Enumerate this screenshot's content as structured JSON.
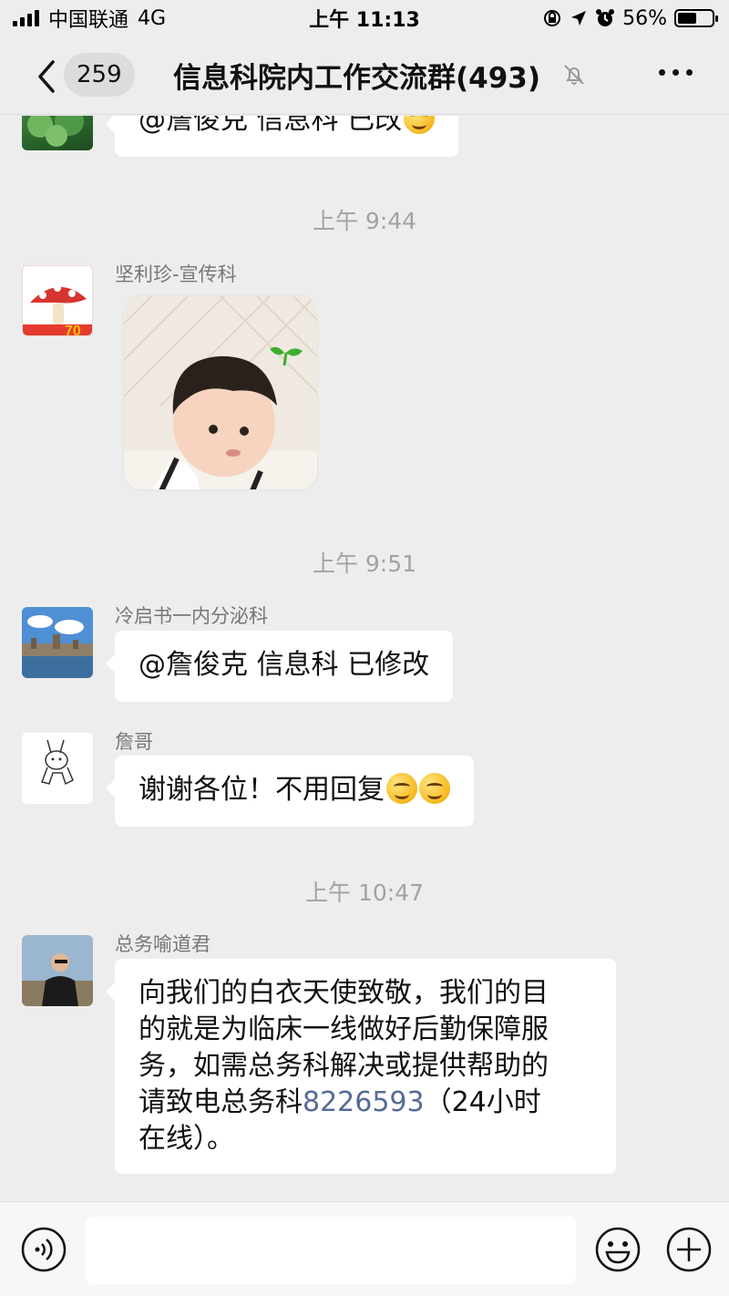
{
  "status_bar": {
    "carrier": "中国联通",
    "network": "4G",
    "time": "上午 11:13",
    "battery_percent": "56%",
    "battery_level": 0.56
  },
  "header": {
    "back_icon": "chevron-left-icon",
    "unread_count": "259",
    "title": "信息科院内工作交流群(493)",
    "mute_icon": "bell-slash-icon",
    "more_icon": "more-dots-icon"
  },
  "messages": [
    {
      "type": "text",
      "text": "@詹俊克 信息科 已改",
      "emoji_count": 1
    },
    {
      "type": "time",
      "text": "上午 9:44"
    },
    {
      "type": "sticker",
      "sender": "坚利珍-宣传科"
    },
    {
      "type": "time",
      "text": "上午 9:51"
    },
    {
      "type": "text",
      "sender": "冷启书一内分泌科",
      "text": "@詹俊克 信息科 已修改"
    },
    {
      "type": "text",
      "sender": "詹哥",
      "text": "谢谢各位！不用回复",
      "emoji_count": 2
    },
    {
      "type": "time",
      "text": "上午 10:47"
    },
    {
      "type": "text",
      "sender": "总务喻道君",
      "lines": [
        "向我们的白衣天使致敬，我们的目",
        "的就是为临床一线做好后勤保障服",
        "务，如需总务科解决或提供帮助的"
      ],
      "line4_prefix": "请致电总务科",
      "phone": "8226593",
      "line4_suffix": "（24小时",
      "line5": "在线）。"
    }
  ],
  "input_bar": {
    "voice_icon": "voice-icon",
    "emoji_icon": "emoji-icon",
    "plus_icon": "plus-circle-icon"
  }
}
